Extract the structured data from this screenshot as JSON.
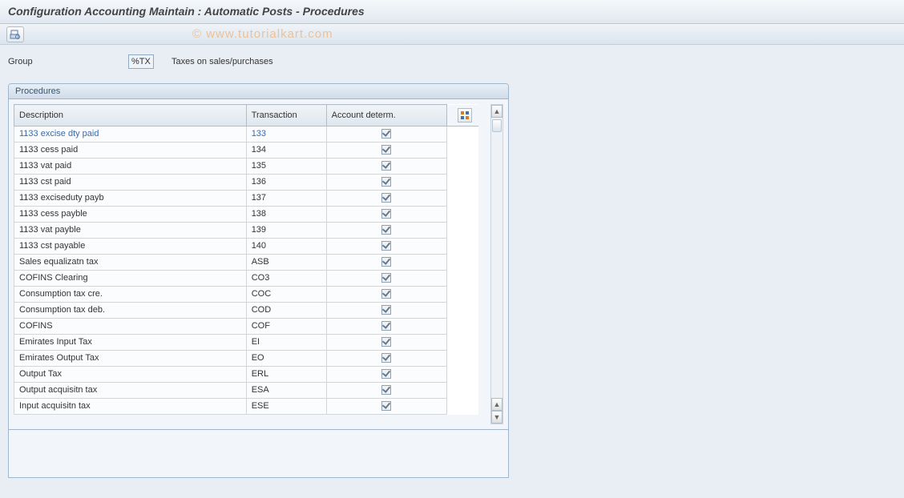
{
  "title": "Configuration Accounting Maintain : Automatic Posts - Procedures",
  "watermark": "© www.tutorialkart.com",
  "group": {
    "label": "Group",
    "value": "%TX",
    "description": "Taxes on sales/purchases"
  },
  "panel": {
    "title": "Procedures",
    "columns": {
      "description": "Description",
      "transaction": "Transaction",
      "account_determ": "Account determ."
    },
    "rows": [
      {
        "desc": "1133 excise dty paid",
        "tx": "133",
        "chk": true,
        "selected": true
      },
      {
        "desc": "1133 cess paid",
        "tx": "134",
        "chk": true
      },
      {
        "desc": "1133 vat paid",
        "tx": "135",
        "chk": true
      },
      {
        "desc": "1133 cst paid",
        "tx": "136",
        "chk": true
      },
      {
        "desc": "1133 exciseduty payb",
        "tx": "137",
        "chk": true
      },
      {
        "desc": "1133 cess payble",
        "tx": "138",
        "chk": true
      },
      {
        "desc": "1133 vat payble",
        "tx": "139",
        "chk": true
      },
      {
        "desc": "1133 cst payable",
        "tx": "140",
        "chk": true
      },
      {
        "desc": "Sales equalizatn tax",
        "tx": "ASB",
        "chk": true
      },
      {
        "desc": "COFINS Clearing",
        "tx": "CO3",
        "chk": true
      },
      {
        "desc": "Consumption tax cre.",
        "tx": "COC",
        "chk": true
      },
      {
        "desc": "Consumption tax deb.",
        "tx": "COD",
        "chk": true
      },
      {
        "desc": "COFINS",
        "tx": "COF",
        "chk": true
      },
      {
        "desc": "Emirates Input Tax",
        "tx": "EI",
        "chk": true
      },
      {
        "desc": "Emirates Output Tax",
        "tx": "EO",
        "chk": true
      },
      {
        "desc": "Output Tax",
        "tx": "ERL",
        "chk": true
      },
      {
        "desc": "Output acquisitn tax",
        "tx": "ESA",
        "chk": true
      },
      {
        "desc": "Input acquisitn tax",
        "tx": "ESE",
        "chk": true
      }
    ]
  }
}
